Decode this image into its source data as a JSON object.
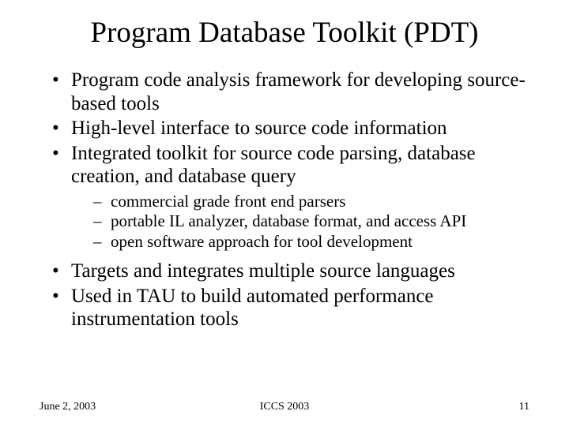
{
  "title": "Program Database Toolkit (PDT)",
  "bullets": {
    "b1_pre": "Program code analysis framework",
    "b1_post": " for developing source-based tools",
    "b2_pre": "High-level interface",
    "b2_post": " to source code information",
    "b3_pre": "Integrated toolkit",
    "b3_post": " for source code parsing, database creation, and database query",
    "b4_pre": "Targets and integrates ",
    "b4_post": "multiple source languages",
    "b5_pre": "Used in TAU to build ",
    "b5_post": "automated performance instrumentation tools"
  },
  "sub": {
    "s1": "commercial grade front end parsers",
    "s2": "portable IL analyzer, database format, and access API",
    "s3": "open software approach for tool development"
  },
  "footer": {
    "date": "June 2, 2003",
    "venue": "ICCS 2003",
    "page": "11"
  }
}
